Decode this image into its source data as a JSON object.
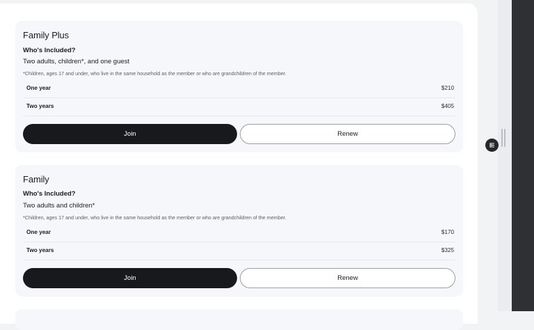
{
  "plans": [
    {
      "title": "Family Plus",
      "included_heading": "Who's Included?",
      "included_value": "Two adults, children*, and one guest",
      "note": "*Children, ages 17 and under, who live in the same household as the member or who are grandchildren of the member.",
      "prices": [
        {
          "label": "One year",
          "price": "$210"
        },
        {
          "label": "Two years",
          "price": "$405"
        }
      ],
      "join_label": "Join",
      "renew_label": "Renew"
    },
    {
      "title": "Family",
      "included_heading": "Who's Included?",
      "included_value": "Two adults and children*",
      "note": "*Children, ages 17 and under, who live in the same household as the member or who are grandchildren of the member.",
      "prices": [
        {
          "label": "One year",
          "price": "$170"
        },
        {
          "label": "Two years",
          "price": "$325"
        }
      ],
      "join_label": "Join",
      "renew_label": "Renew"
    }
  ],
  "icons": {
    "floating_button": "filter-settings-icon",
    "rail_handle": "drag-handle-icon"
  }
}
